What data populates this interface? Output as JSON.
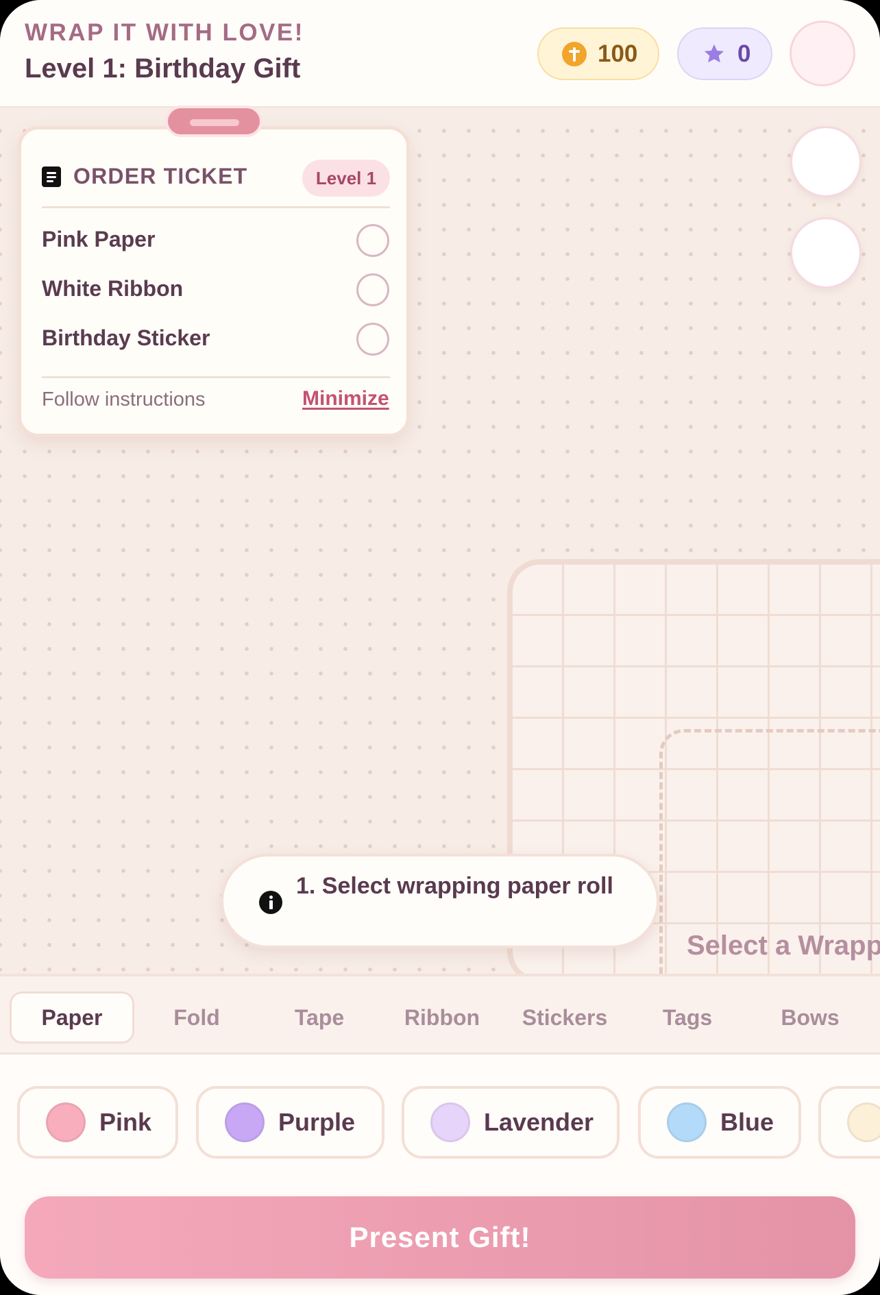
{
  "header": {
    "app_title": "WRAP IT WITH LOVE!",
    "level_title": "Level 1: Birthday Gift",
    "coins": "100",
    "stars": "0"
  },
  "ticket": {
    "title": "ORDER TICKET",
    "level_badge": "Level 1",
    "items": [
      {
        "label": "Pink Paper"
      },
      {
        "label": "White Ribbon"
      },
      {
        "label": "Birthday Sticker"
      }
    ],
    "footer": "Follow instructions",
    "minimize_label": "Minimize"
  },
  "instruction": {
    "text": "1. Select wrapping paper roll"
  },
  "board": {
    "hint": "Select a Wrapping"
  },
  "tabs": [
    {
      "label": "Paper",
      "active": true
    },
    {
      "label": "Fold"
    },
    {
      "label": "Tape"
    },
    {
      "label": "Ribbon"
    },
    {
      "label": "Stickers"
    },
    {
      "label": "Tags"
    },
    {
      "label": "Bows"
    }
  ],
  "paper_options": [
    {
      "label": "Pink",
      "color": "#f9aebd"
    },
    {
      "label": "Purple",
      "color": "#c8a8f5"
    },
    {
      "label": "Lavender",
      "color": "#e6d4fa"
    },
    {
      "label": "Blue",
      "color": "#b3daf9"
    },
    {
      "label": "",
      "color": "#fcf0d8"
    }
  ],
  "present_button": "Present Gift!",
  "colors": {
    "accent_pink": "#e493a6",
    "title_plum": "#5a3a4e",
    "coin_gold": "#f1a52a",
    "star_purple": "#9b7de3"
  },
  "icons": {
    "coin": "coin-icon",
    "star": "star-icon",
    "ticket": "document-icon",
    "info": "info-icon"
  }
}
